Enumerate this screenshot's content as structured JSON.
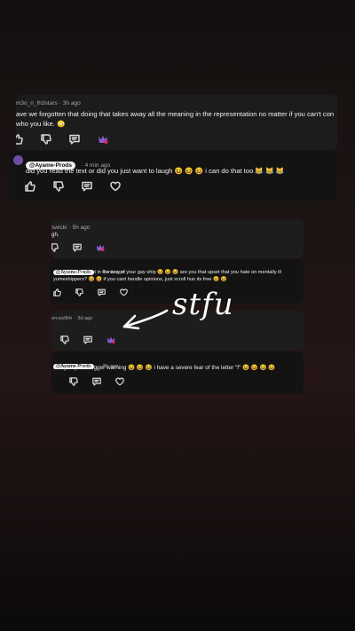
{
  "comments": {
    "c1": {
      "user": "m3o_n_th3stars",
      "time": "3h ago",
      "text": "ave we forgotten that doing that takes away all the meaning in the representation no matter if you can't con",
      "text2": "who you like. 😳"
    },
    "c2": {
      "mention": "@Ayame-Prods",
      "time": "4 min ago",
      "text": "did you read the text or did you just want to laugh 😆 😆 😆  i can do that too 😹 😹 😹"
    },
    "c3": {
      "user": "swicki",
      "time": "5h ago",
      "text": "gh."
    },
    "c4": {
      "mention": "@Ayame-Prods",
      "time": "5 min ago",
      "text": "o-oh no! does it get in the way of your gay ship 😆 😆 😆  are you that upset that you hate on mentally ill",
      "text2": "yumeshippers? 😆 😆  if you cant handle opinions, just scroll hun its free 😆 😆"
    },
    "c5": {
      "user": "en-ps9hh",
      "time": "3d ago"
    },
    "c6": {
      "mention": "@Ayame-Prods",
      "time": "8h ago",
      "text": "can you put a trigger warning 😆 😆 😆  i have a severe fear of the letter \"f\"  😆 😆 😆 😆"
    }
  },
  "annotation": {
    "text": "stfu"
  },
  "icons": [
    "thumbs-up-icon",
    "thumbs-down-icon",
    "reply-icon",
    "heart-icon",
    "award-icon"
  ]
}
